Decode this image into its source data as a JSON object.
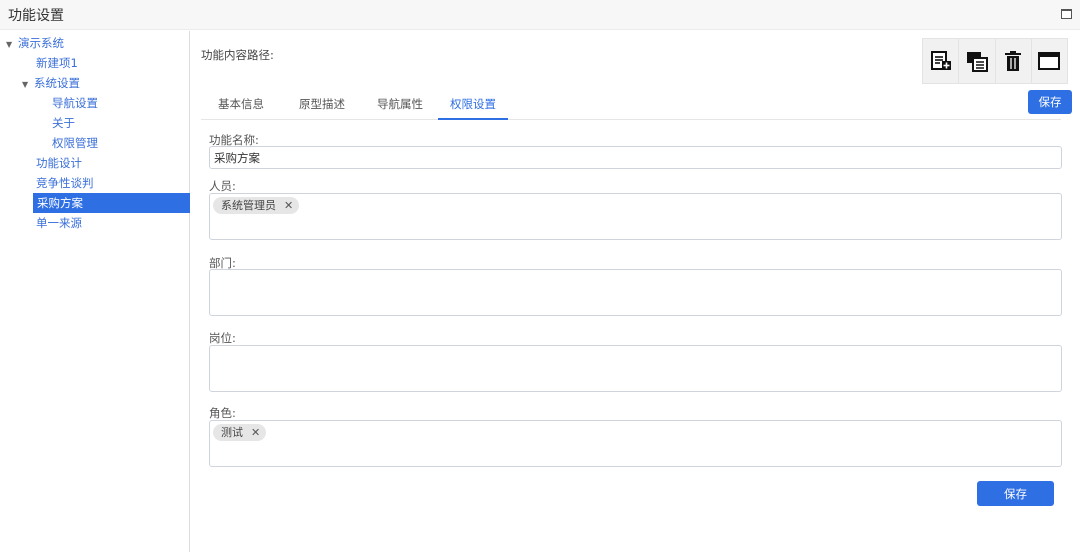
{
  "window": {
    "title": "功能设置"
  },
  "tree": {
    "root": "演示系统",
    "items": [
      "新建项1",
      "系统设置",
      "导航设置",
      "关于",
      "权限管理",
      "功能设计",
      "竞争性谈判",
      "采购方案",
      "单一来源"
    ],
    "selected": "采购方案"
  },
  "main": {
    "path_label": "功能内容路径:",
    "toolbar_icons": [
      "add-document-icon",
      "copy-window-icon",
      "trash-icon",
      "window-icon"
    ],
    "tabs": [
      {
        "label": "基本信息",
        "active": false
      },
      {
        "label": "原型描述",
        "active": false
      },
      {
        "label": "导航属性",
        "active": false
      },
      {
        "label": "权限设置",
        "active": true
      }
    ],
    "save_top": "保存",
    "save_bottom": "保存"
  },
  "form": {
    "name_label": "功能名称:",
    "name_value": "采购方案",
    "person_label": "人员:",
    "person_tags": [
      "系统管理员"
    ],
    "dept_label": "部门:",
    "position_label": "岗位:",
    "role_label": "角色:",
    "role_tags": [
      "测试"
    ],
    "tag_remove": "✕"
  },
  "colors": {
    "accent": "#2f6fe4",
    "link": "#3a6fd8"
  }
}
